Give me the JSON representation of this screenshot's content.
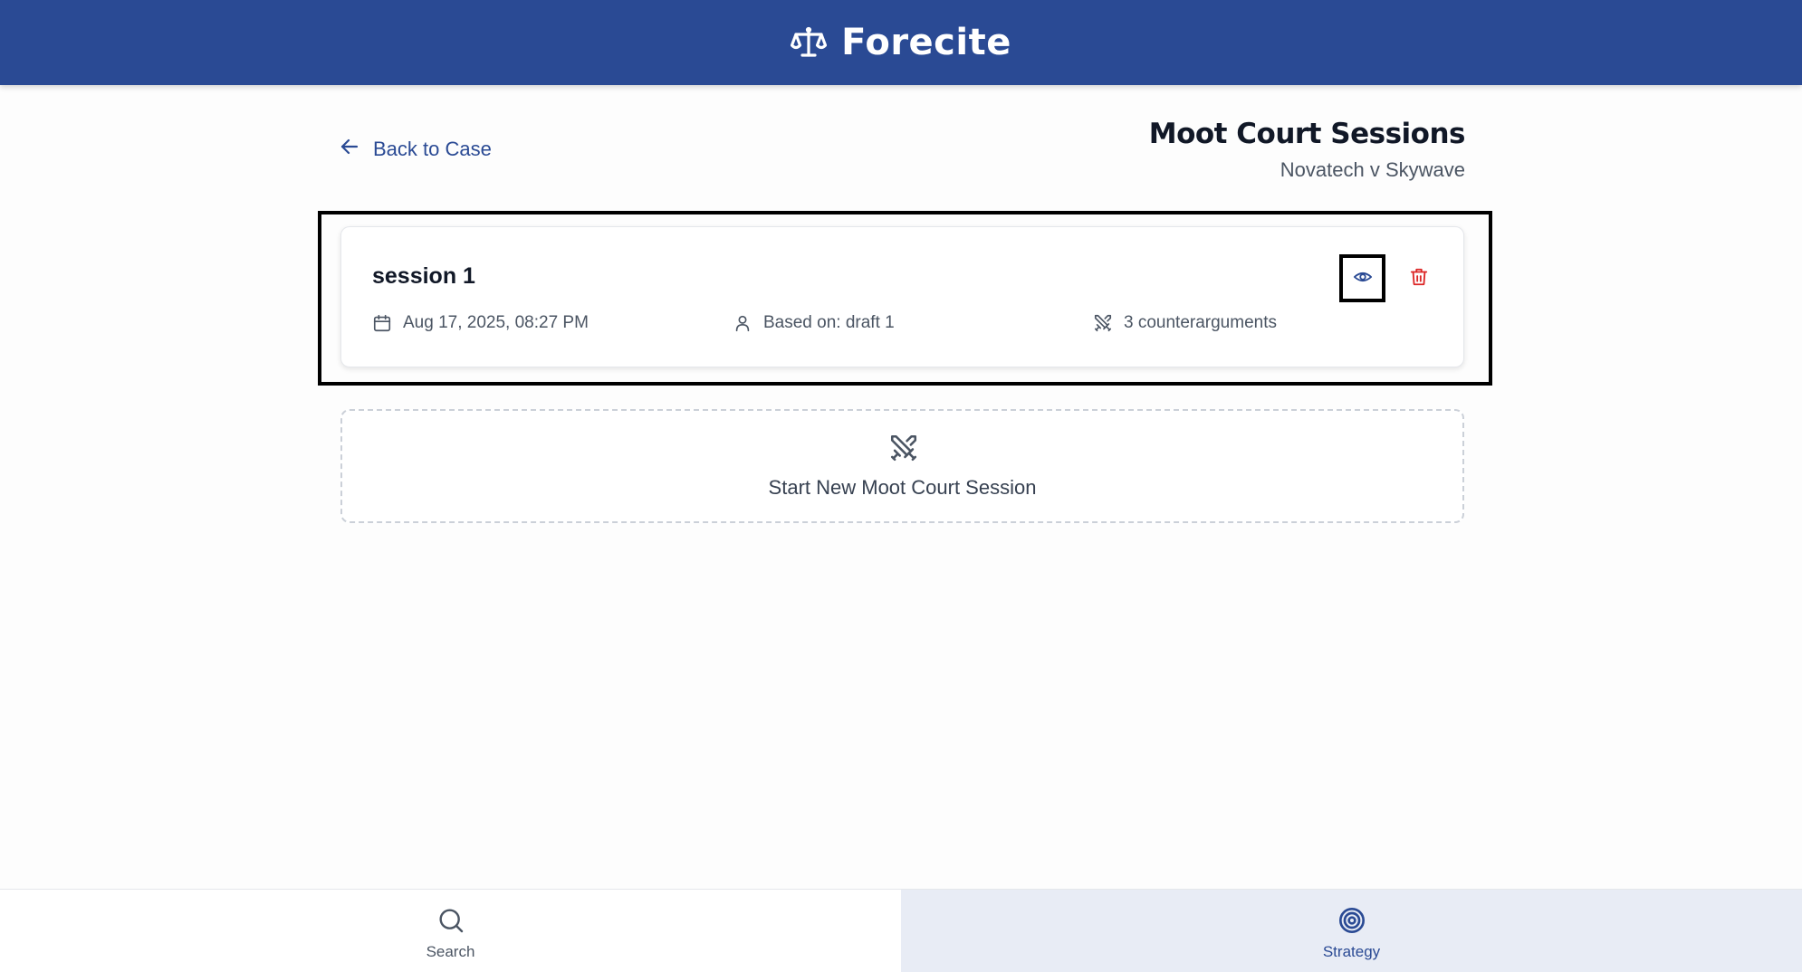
{
  "app": {
    "name": "Forecite",
    "logo_icon": "scales-icon"
  },
  "colors": {
    "brand": "#2a4a94",
    "danger": "#dc2626",
    "active_tab_bg": "#e8ecf5"
  },
  "header": {
    "back_label": "Back to Case",
    "title": "Moot Court Sessions",
    "subtitle": "Novatech v Skywave"
  },
  "sessions": [
    {
      "title": "session 1",
      "date": "Aug 17, 2025, 08:27 PM",
      "based_on": "Based on: draft 1",
      "counterarguments": "3 counterarguments",
      "actions": [
        "eye-icon",
        "trash-icon"
      ]
    }
  ],
  "new_session": {
    "label": "Start New Moot Court Session",
    "icon": "swords-icon"
  },
  "bottom_nav": {
    "tabs": [
      {
        "label": "Search",
        "icon": "search-icon",
        "active": false
      },
      {
        "label": "Strategy",
        "icon": "target-icon",
        "active": true
      }
    ]
  }
}
